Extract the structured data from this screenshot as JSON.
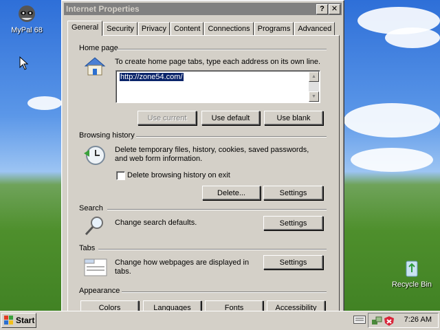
{
  "desktop": {
    "icons": [
      {
        "label": "MyPal 68"
      },
      {
        "label": "Recycle Bin"
      }
    ]
  },
  "window": {
    "title": "Internet Properties",
    "help_button": "?",
    "close_button": "✕",
    "tabs": [
      {
        "label": "General",
        "active": true
      },
      {
        "label": "Security"
      },
      {
        "label": "Privacy"
      },
      {
        "label": "Content"
      },
      {
        "label": "Connections"
      },
      {
        "label": "Programs"
      },
      {
        "label": "Advanced"
      }
    ],
    "home_page": {
      "title": "Home page",
      "description": "To create home page tabs, type each address on its own line.",
      "value": "http://zone54.com/",
      "use_current": "Use current",
      "use_default": "Use default",
      "use_blank": "Use blank"
    },
    "browsing_history": {
      "title": "Browsing history",
      "description_1": "Delete temporary files, history, cookies, saved passwords,",
      "description_2": "and web form information.",
      "checkbox_label": "Delete browsing history on exit",
      "checkbox_checked": false,
      "delete_button": "Delete...",
      "settings_button": "Settings"
    },
    "search": {
      "title": "Search",
      "description": "Change search defaults.",
      "settings_button": "Settings"
    },
    "tabs_section": {
      "title": "Tabs",
      "description_1": "Change how webpages are displayed in",
      "description_2": "tabs.",
      "settings_button": "Settings"
    },
    "appearance": {
      "title": "Appearance",
      "colors": "Colors",
      "languages": "Languages",
      "fonts": "Fonts",
      "accessibility": "Accessibility"
    }
  },
  "taskbar": {
    "start_label": "Start",
    "clock": "7:26 AM"
  }
}
